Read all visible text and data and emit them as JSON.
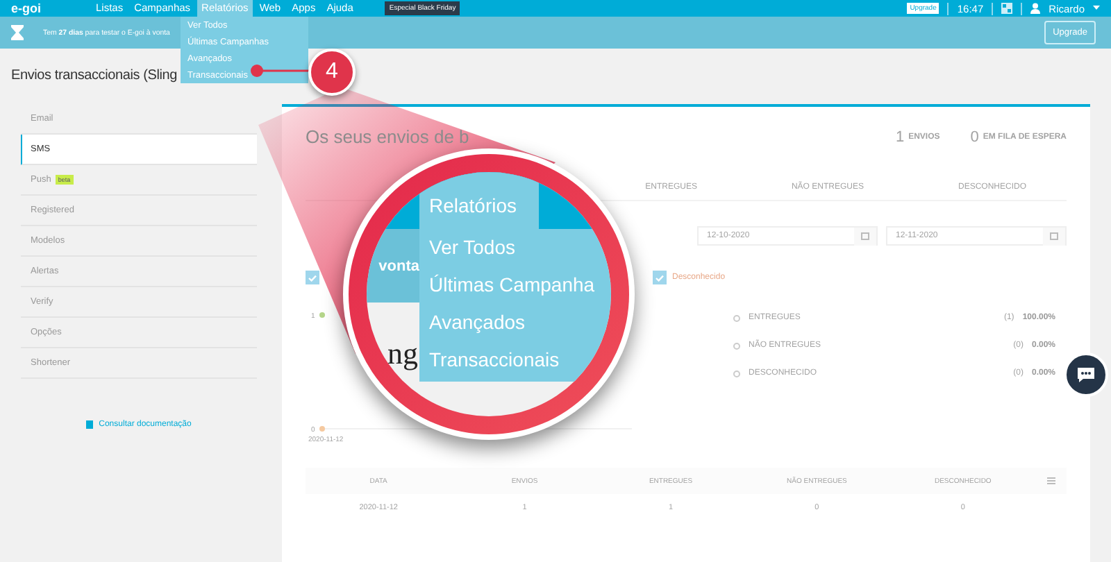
{
  "topbar": {
    "logo": "e-goi",
    "menu": [
      {
        "label": "Listas",
        "selected": false
      },
      {
        "label": "Campanhas",
        "selected": false
      },
      {
        "label": "Relatórios",
        "selected": true
      },
      {
        "label": "Web",
        "selected": false
      },
      {
        "label": "Apps",
        "selected": false
      },
      {
        "label": "Ajuda",
        "selected": false
      }
    ],
    "promo": "Especial Black Friday",
    "upgrade_badge": "Upgrade",
    "time": "16:47",
    "user": "Ricardo"
  },
  "dropdown": {
    "items": [
      "Ver Todos",
      "Últimas Campanhas",
      "Avançados",
      "Transaccionais"
    ]
  },
  "trial_bar": {
    "message": "Tem **27 dias** para testar o E-goi à vonta",
    "button": "Upgrade"
  },
  "page_title": "Envios transaccionais (Sling",
  "sidebar": {
    "items": [
      {
        "label": "Email",
        "selected": false
      },
      {
        "label": "SMS",
        "selected": true
      },
      {
        "label": "Push",
        "selected": false,
        "badge": "beta"
      },
      {
        "label": "Registered",
        "selected": false
      },
      {
        "label": "Modelos",
        "selected": false
      },
      {
        "label": "Alertas",
        "selected": false
      },
      {
        "label": "Verify",
        "selected": false
      },
      {
        "label": "Opções",
        "selected": false
      },
      {
        "label": "Shortener",
        "selected": false
      }
    ],
    "doc_link": "Consultar documentação"
  },
  "card": {
    "heading": "Os seus envios de b",
    "stats": [
      {
        "value": "1",
        "label": "ENVIOS"
      },
      {
        "value": "0",
        "label": "EM FILA DE ESPERA"
      }
    ],
    "tabs": [
      {
        "label": "ENTREGUES",
        "selected": false
      },
      {
        "label": "NÃO ENTREGUES",
        "selected": false
      },
      {
        "label": "DESCONHECIDO",
        "selected": false
      }
    ],
    "date_from": "12-10-2020",
    "date_to": "12-11-2020",
    "checks": [
      {
        "checked": true
      },
      {
        "checked": true
      }
    ],
    "chart_data": {
      "type": "line",
      "x": [
        "2020-11-12"
      ],
      "ylim": [
        0,
        1
      ],
      "yticks": [
        0,
        1
      ],
      "series": [
        {
          "color": "#b5d58a",
          "marker": "o",
          "values": [
            1
          ]
        },
        {
          "name": "Desconhecido",
          "color": "#f5c9a0",
          "marker": "o",
          "values": [
            0
          ]
        }
      ]
    },
    "summary": [
      {
        "label": "ENTREGUES",
        "count": "(1)",
        "percent": "100.00%"
      },
      {
        "label": "NÃO ENTREGUES",
        "count": "(0)",
        "percent": "0.00%"
      },
      {
        "label": "DESCONHECIDO",
        "count": "(0)",
        "percent": "0.00%"
      }
    ],
    "table": {
      "columns": [
        "DATA",
        "ENVIOS",
        "ENTREGUES",
        "NÃO ENTREGUES",
        "DESCONHECIDO"
      ],
      "rows": [
        [
          "2020-11-12",
          "1",
          "1",
          "0",
          "0"
        ]
      ]
    }
  },
  "step": {
    "number": "4"
  },
  "zoom": {
    "menu_label": "Relatórios",
    "items": [
      "Ver Todos",
      "Últimas Campanha",
      "Avançados",
      "Transaccionais"
    ],
    "bar_text": "vonta",
    "page_text": "ng"
  }
}
